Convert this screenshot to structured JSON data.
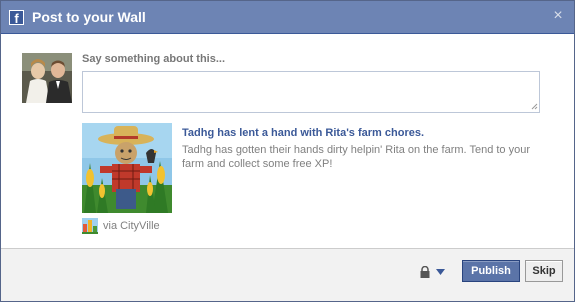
{
  "titlebar": {
    "logo": "f",
    "title": "Post to your Wall",
    "close_glyph": "×"
  },
  "composer": {
    "prompt": "Say something about this...",
    "message_value": ""
  },
  "story": {
    "title": "Tadhg has lent a hand with Rita's farm chores.",
    "description": "Tadhg has gotten their hands dirty helpin' Rita on the farm. Tend to your farm and collect some free XP!",
    "via_label": "via CityVille"
  },
  "footer": {
    "publish_label": "Publish",
    "skip_label": "Skip"
  },
  "icons": {
    "close": "close-icon",
    "lock": "lock-icon",
    "privacy_caret": "chevron-down-icon",
    "app": "cityville-app-icon"
  },
  "colors": {
    "titlebar": "#6d84b4",
    "link": "#3b5998",
    "publish": "#5b74a8",
    "footer": "#f2f2f2"
  }
}
